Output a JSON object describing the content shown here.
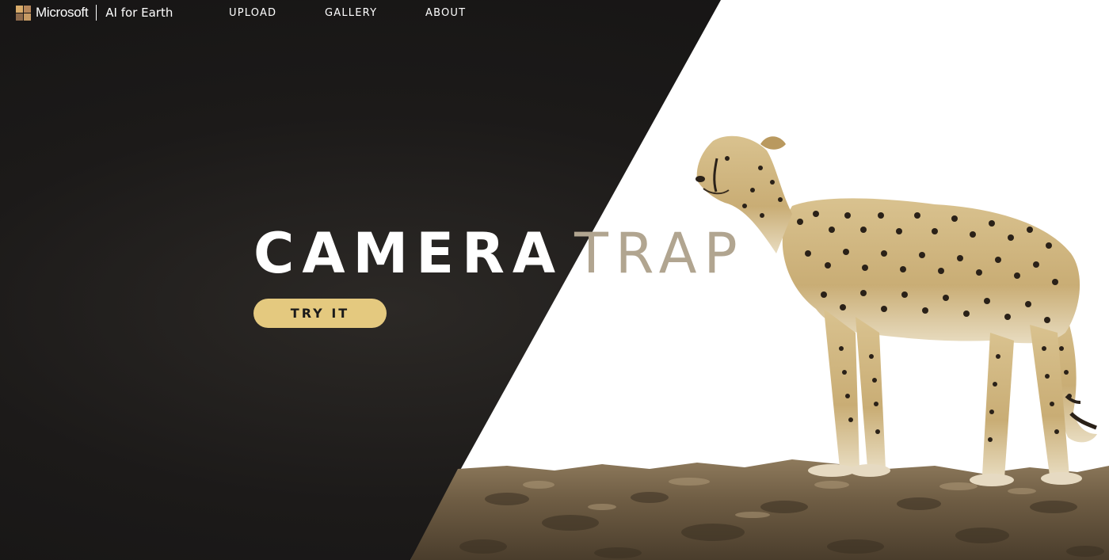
{
  "brand": {
    "company": "Microsoft",
    "product": "AI for Earth",
    "logo_colors": [
      "#d8ab6a",
      "#b5865a",
      "#8e6b4d",
      "#c69a64"
    ]
  },
  "nav": {
    "items": [
      {
        "label": "UPLOAD"
      },
      {
        "label": "GALLERY"
      },
      {
        "label": "ABOUT"
      }
    ]
  },
  "hero": {
    "title_primary": "CAMERA",
    "title_secondary": "TRAP",
    "cta_label": "TRY IT",
    "image": "cheetah standing on rock"
  },
  "colors": {
    "dark_background": "#1c1a19",
    "accent_gold": "#e4c97f",
    "title_secondary": "#b1a590"
  }
}
